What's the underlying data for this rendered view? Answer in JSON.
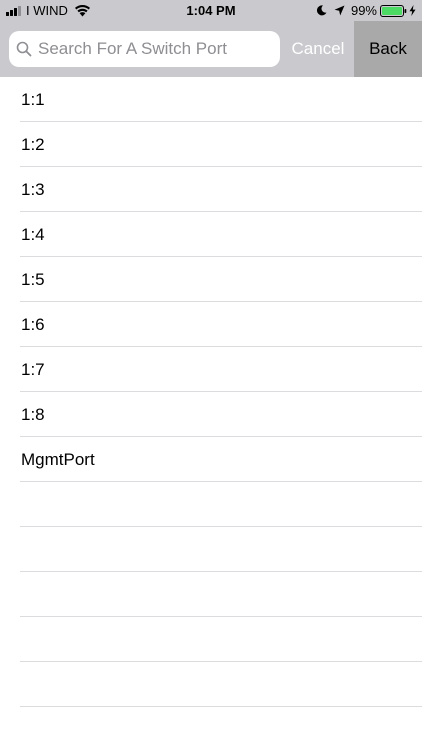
{
  "status_bar": {
    "carrier": "I WIND",
    "time": "1:04 PM",
    "battery_percent": "99%",
    "icons": [
      "signal-icon",
      "wifi-icon",
      "moon-icon",
      "location-icon",
      "battery-icon",
      "charging-bolt-icon"
    ]
  },
  "search": {
    "placeholder": "Search For A Switch Port",
    "value": "",
    "cancel_label": "Cancel",
    "back_label": "Back",
    "icon": "search-icon"
  },
  "ports": [
    "1:1",
    "1:2",
    "1:3",
    "1:4",
    "1:5",
    "1:6",
    "1:7",
    "1:8",
    "MgmtPort"
  ],
  "colors": {
    "bar_background": "#c9c9ce",
    "back_button_background": "#a9a9a9",
    "separator": "#dcdcdf",
    "battery_fill": "#4cd964"
  }
}
